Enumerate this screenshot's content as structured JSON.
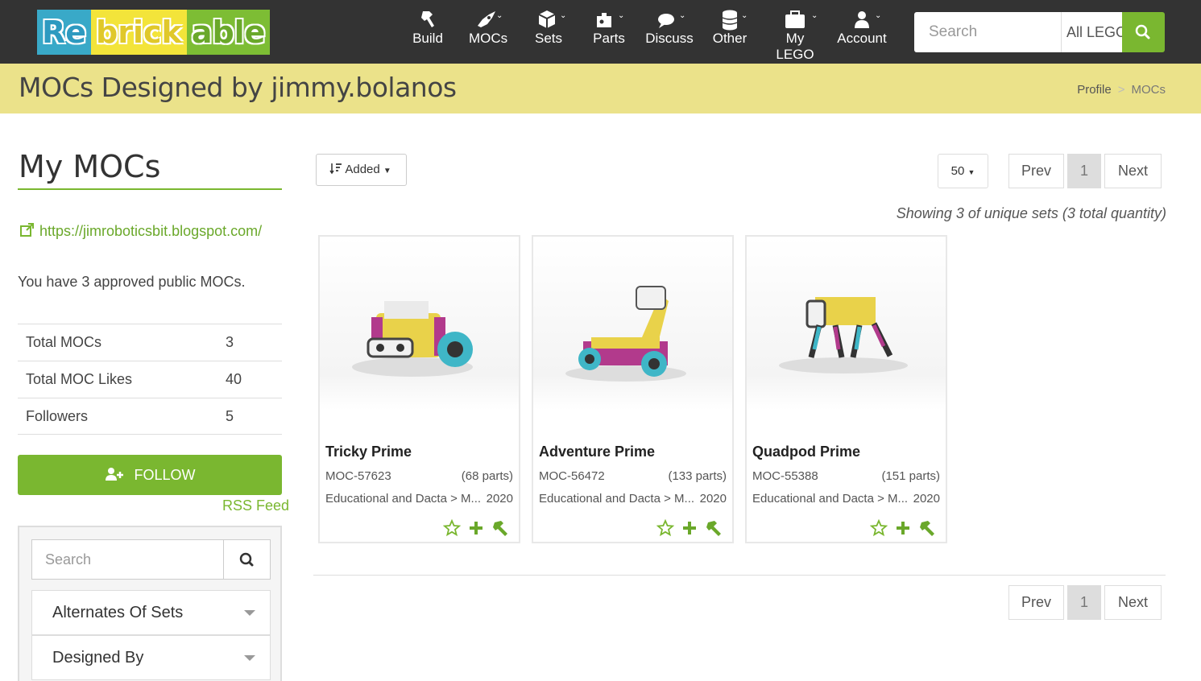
{
  "header": {
    "logo": [
      "Re",
      "brick",
      "able"
    ],
    "nav": [
      {
        "label": "Build",
        "icon": "hammer-icon"
      },
      {
        "label": "MOCs",
        "icon": "rocket-icon"
      },
      {
        "label": "Sets",
        "icon": "cube-icon"
      },
      {
        "label": "Parts",
        "icon": "puzzle-icon"
      },
      {
        "label": "Discuss",
        "icon": "comments-icon"
      },
      {
        "label": "Other",
        "icon": "database-icon"
      },
      {
        "label": "My LEGO",
        "icon": "briefcase-icon"
      },
      {
        "label": "Account",
        "icon": "user-icon"
      }
    ],
    "search_placeholder": "Search",
    "search_scope": "All LEGO",
    "colors": {
      "bar": "#333333",
      "accent": "#7ab730"
    }
  },
  "page": {
    "title": "MOCs Designed by jimmy.bolanos",
    "breadcrumb": [
      "Profile",
      "MOCs"
    ]
  },
  "sidebar": {
    "title": "My MOCs",
    "link": "https://jimroboticsbit.blogspot.com/",
    "note": "You have 3 approved public MOCs.",
    "stats": [
      {
        "label": "Total MOCs",
        "value": "3"
      },
      {
        "label": "Total MOC Likes",
        "value": "40"
      },
      {
        "label": "Followers",
        "value": "5"
      }
    ],
    "follow_label": "FOLLOW",
    "rss_label": "RSS Feed",
    "filter_search_placeholder": "Search",
    "filters": [
      "Alternates Of Sets",
      "Designed By"
    ]
  },
  "toolbar": {
    "sort_label": "Added",
    "per_page": "50",
    "prev": "Prev",
    "page": "1",
    "next": "Next",
    "showing": "Showing 3 of unique sets (3 total quantity)"
  },
  "mocs": [
    {
      "name": "Tricky Prime",
      "number": "MOC-57623",
      "parts": "(68 parts)",
      "theme": "Educational and Dacta > M...",
      "year": "2020"
    },
    {
      "name": "Adventure Prime",
      "number": "MOC-56472",
      "parts": "(133 parts)",
      "theme": "Educational and Dacta > M...",
      "year": "2020"
    },
    {
      "name": "Quadpod Prime",
      "number": "MOC-55388",
      "parts": "(151 parts)",
      "theme": "Educational and Dacta > M...",
      "year": "2020"
    }
  ]
}
